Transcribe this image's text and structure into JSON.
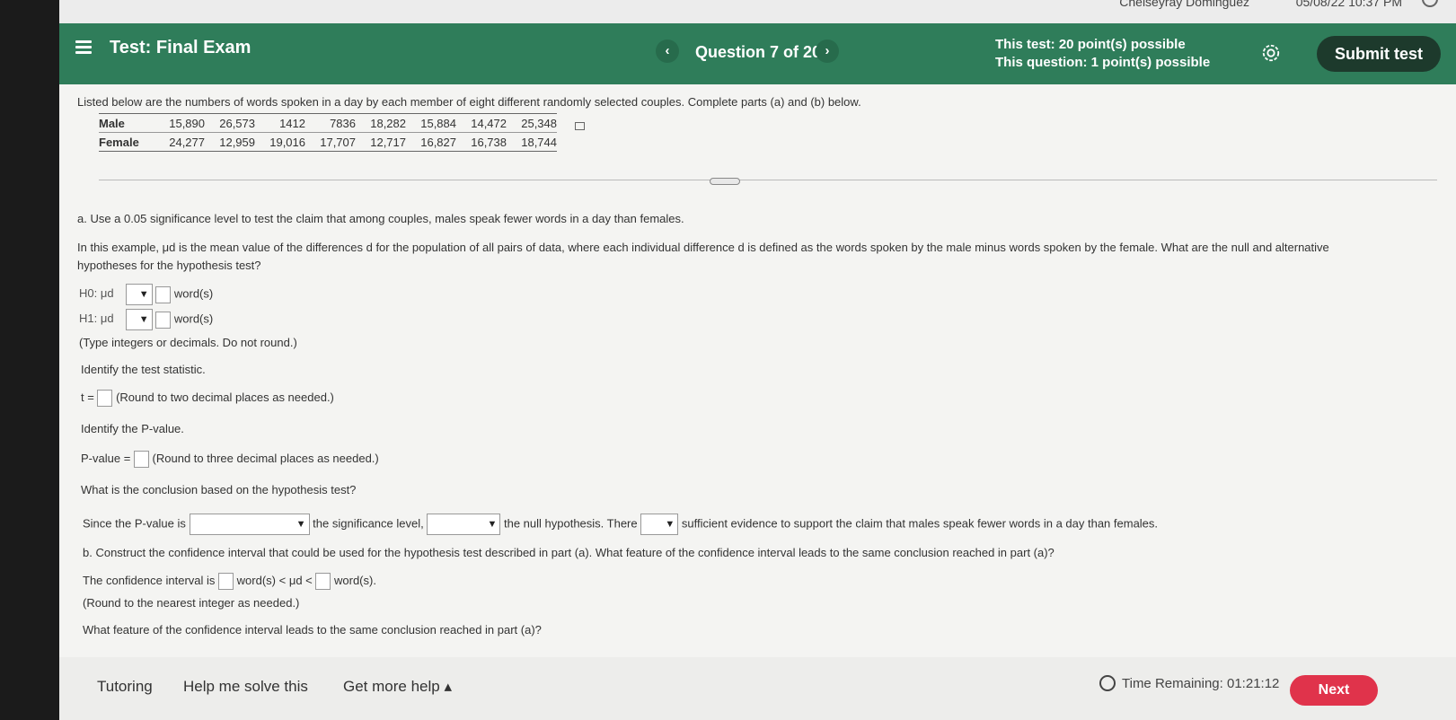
{
  "top": {
    "user": "Chelseyray Dominguez",
    "datetime": "05/08/22 10:37 PM"
  },
  "header": {
    "title": "Test: Final Exam",
    "question_counter": "Question 7 of 20",
    "test_points": "This test: 20 point(s) possible",
    "question_points": "This question: 1 point(s) possible",
    "submit_label": "Submit test",
    "prev_glyph": "‹",
    "next_glyph": "›"
  },
  "problem": {
    "intro": "Listed below are the numbers of words spoken in a day by each member of eight different randomly selected couples. Complete parts (a) and (b) below.",
    "table": {
      "male_label": "Male",
      "female_label": "Female",
      "male": [
        "15,890",
        "26,573",
        "1412",
        "7836",
        "18,282",
        "15,884",
        "14,472",
        "25,348"
      ],
      "female": [
        "24,277",
        "12,959",
        "19,016",
        "17,707",
        "12,717",
        "16,827",
        "16,738",
        "18,744"
      ]
    },
    "part_a": "a. Use a 0.05 significance level to test the claim that among couples, males speak fewer words in a day than females.",
    "example_line1": "In this example, μd is the mean value of the differences d for the population of all pairs of data, where each individual difference d is defined as the words spoken by the male minus words spoken by the female. What are the null and alternative",
    "example_line2": "hypotheses for the hypothesis test?",
    "h0_label": "H0: μd",
    "h1_label": "H1: μd",
    "unit_words": "word(s)",
    "type_note": "(Type integers or decimals. Do not round.)",
    "identify_stat": "Identify the test statistic.",
    "t_label": "t =",
    "t_note": "(Round to two decimal places as needed.)",
    "identify_p": "Identify the P-value.",
    "p_label": "P-value =",
    "p_note": "(Round to three decimal places as needed.)",
    "conclusion_q": "What is the conclusion based on the hypothesis test?",
    "since_text": "Since the P-value is",
    "sig_text": "the significance level,",
    "null_text": "the null hypothesis. There",
    "evidence_text": "sufficient evidence to support the claim that males speak fewer words in a day than females.",
    "part_b": "b. Construct the confidence interval that could be used for the hypothesis test described in part (a). What feature of the confidence interval leads to the same conclusion reached in part (a)?",
    "ci_label": "The confidence interval is",
    "ci_mid": "word(s) < μd <",
    "ci_end": "word(s).",
    "round_note": "(Round to the nearest integer as needed.)",
    "feature_q": "What feature of the confidence interval leads to the same conclusion reached in part (a)?"
  },
  "footer": {
    "tutoring": "Tutoring",
    "help_solve": "Help me solve this",
    "more_help": "Get more help ▴",
    "time_label": "Time Remaining:",
    "time_value": "01:21:12",
    "next_label": "Next"
  }
}
